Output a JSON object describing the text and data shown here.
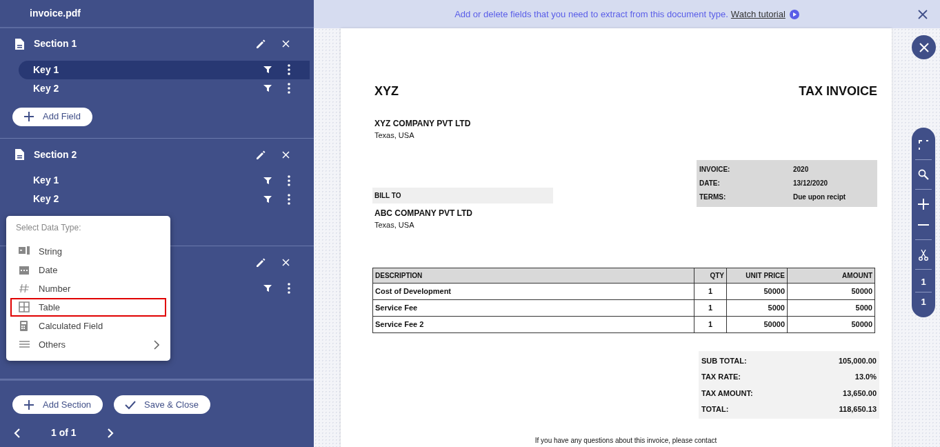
{
  "sidebar": {
    "file_name": "invoice.pdf",
    "sections": [
      {
        "title": "Section 1",
        "keys": [
          {
            "label": "Key 1",
            "selected": true
          },
          {
            "label": "Key 2",
            "selected": false
          }
        ],
        "add_field": "Add Field"
      },
      {
        "title": "Section 2",
        "keys": [
          {
            "label": "Key 1",
            "selected": false
          },
          {
            "label": "Key 2",
            "selected": false
          }
        ]
      },
      {
        "keys": [
          {
            "selected": false
          }
        ]
      }
    ],
    "buttons": [
      {
        "kind": "add",
        "label": "Add Section"
      },
      {
        "kind": "save",
        "label": "Save & Close"
      }
    ],
    "pagination": "1 of 1"
  },
  "data_type_menu": {
    "title": "Select Data Type:",
    "items": [
      {
        "kind": "string",
        "label": "String",
        "selected": false
      },
      {
        "kind": "date",
        "label": "Date",
        "selected": false
      },
      {
        "kind": "number",
        "label": "Number",
        "selected": false
      },
      {
        "kind": "table",
        "label": "Table",
        "selected": true
      },
      {
        "kind": "calculated",
        "label": "Calculated Field",
        "selected": false
      },
      {
        "kind": "others",
        "label": "Others",
        "selected": false,
        "submenu": true
      }
    ]
  },
  "banner": {
    "text": "Add or delete fields that you need to extract from this document type.",
    "link": "Watch tutorial"
  },
  "document": {
    "logo": "XYZ",
    "title": "TAX INVOICE",
    "company": "XYZ COMPANY PVT LTD",
    "company_address": "Texas, USA",
    "info": [
      [
        "INVOICE:",
        "2020"
      ],
      [
        "DATE:",
        "13/12/2020"
      ],
      [
        "TERMS:",
        "Due upon recipt"
      ]
    ],
    "bill_to": "BILL TO",
    "client": "ABC COMPANY PVT LTD",
    "client_address": "Texas, USA",
    "table": {
      "columns": [
        "DESCRIPTION",
        "QTY",
        "UNIT PRICE",
        "AMOUNT"
      ],
      "rows": [
        [
          "Cost of Development",
          "1",
          "50000",
          "50000"
        ],
        [
          "Service Fee",
          "1",
          "5000",
          "5000"
        ],
        [
          "Service Fee 2",
          "1",
          "50000",
          "50000"
        ]
      ]
    },
    "totals": [
      [
        "SUB TOTAL:",
        "105,000.00"
      ],
      [
        "TAX RATE:",
        "13.0%"
      ],
      [
        "TAX AMOUNT:",
        "13,650.00"
      ],
      [
        "TOTAL:",
        "118,650.13"
      ]
    ],
    "footer": "If you have any questions about this invoice, please contact"
  },
  "toolbar": {
    "page_current": "1",
    "page_total": "1"
  }
}
